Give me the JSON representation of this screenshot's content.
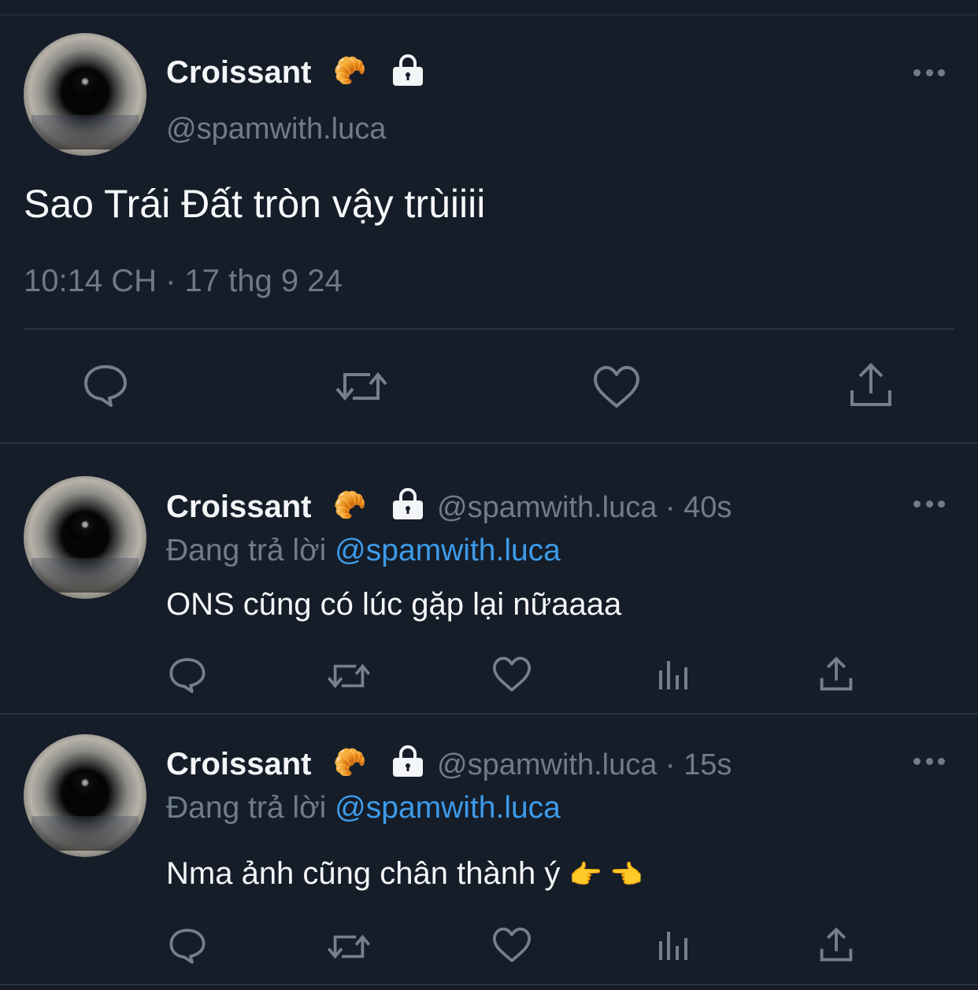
{
  "main_tweet": {
    "name": "Croissant",
    "emoji": "🥐",
    "handle": "@spamwith.luca",
    "text": "Sao Trái Đất tròn vậy trùiiii",
    "timestamp": "10:14 CH · 17 thg 9 24",
    "actions": [
      "reply-icon",
      "retweet-icon",
      "like-icon",
      "share-icon"
    ]
  },
  "replies": [
    {
      "name": "Croissant",
      "emoji": "🥐",
      "handle_time": "@spamwith.luca · 40s",
      "replying_prefix": "Đang trả lời",
      "replying_to": "@spamwith.luca",
      "text": "ONS cũng có lúc gặp lại nữaaaa"
    },
    {
      "name": "Croissant",
      "emoji": "🥐",
      "handle_time": "@spamwith.luca · 15s",
      "replying_prefix": "Đang trả lời",
      "replying_to": "@spamwith.luca",
      "text": "Nma ảnh cũng chân thành ý",
      "text_emojis": "👉 👈"
    }
  ],
  "colors": {
    "background": "#151d29",
    "text": "#f2f5f8",
    "secondary": "#6f7c89",
    "link": "#3d9be9",
    "divider": "#283241"
  }
}
